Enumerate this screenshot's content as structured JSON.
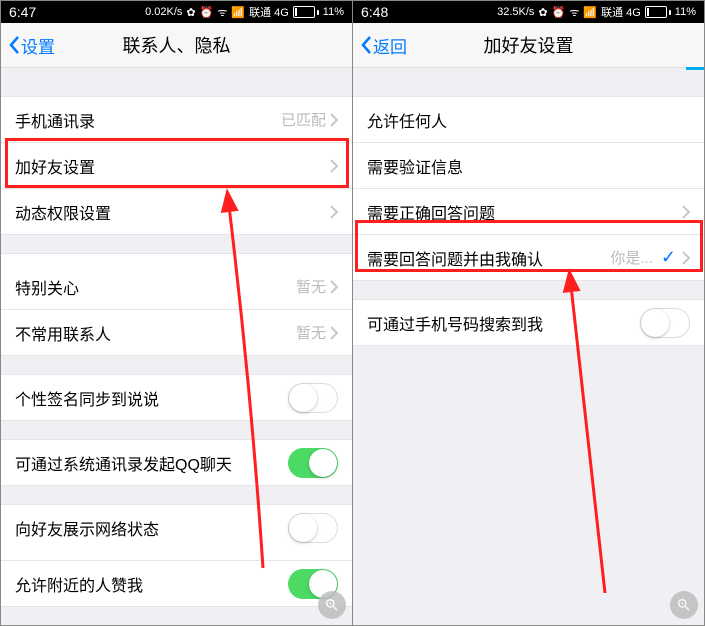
{
  "left": {
    "status": {
      "time": "6:47",
      "speed": "0.02K/s",
      "carrier": "联通 4G",
      "battery": "11%"
    },
    "nav": {
      "back": "设置",
      "title": "联系人、隐私"
    },
    "rows": {
      "contacts": {
        "label": "手机通讯录",
        "value": "已匹配"
      },
      "addFriend": {
        "label": "加好友设置"
      },
      "feedPerm": {
        "label": "动态权限设置"
      },
      "specialFocus": {
        "label": "特别关心",
        "value": "暂无"
      },
      "rareContacts": {
        "label": "不常用联系人",
        "value": "暂无"
      },
      "sigSync": {
        "label": "个性签名同步到说说"
      },
      "sysContactsQQ": {
        "label": "可通过系统通讯录发起QQ聊天"
      },
      "showNet": {
        "label": "向好友展示网络状态"
      },
      "nearbyLike": {
        "label": "允许附近的人赞我"
      }
    }
  },
  "right": {
    "status": {
      "time": "6:48",
      "speed": "32.5K/s",
      "carrier": "联通 4G",
      "battery": "11%"
    },
    "nav": {
      "back": "返回",
      "title": "加好友设置"
    },
    "rows": {
      "anyone": {
        "label": "允许任何人"
      },
      "verify": {
        "label": "需要验证信息"
      },
      "answer": {
        "label": "需要正确回答问题"
      },
      "answerConfirm": {
        "label": "需要回答问题并由我确认",
        "value": "你是..."
      },
      "searchPhone": {
        "label": "可通过手机号码搜索到我"
      }
    }
  }
}
